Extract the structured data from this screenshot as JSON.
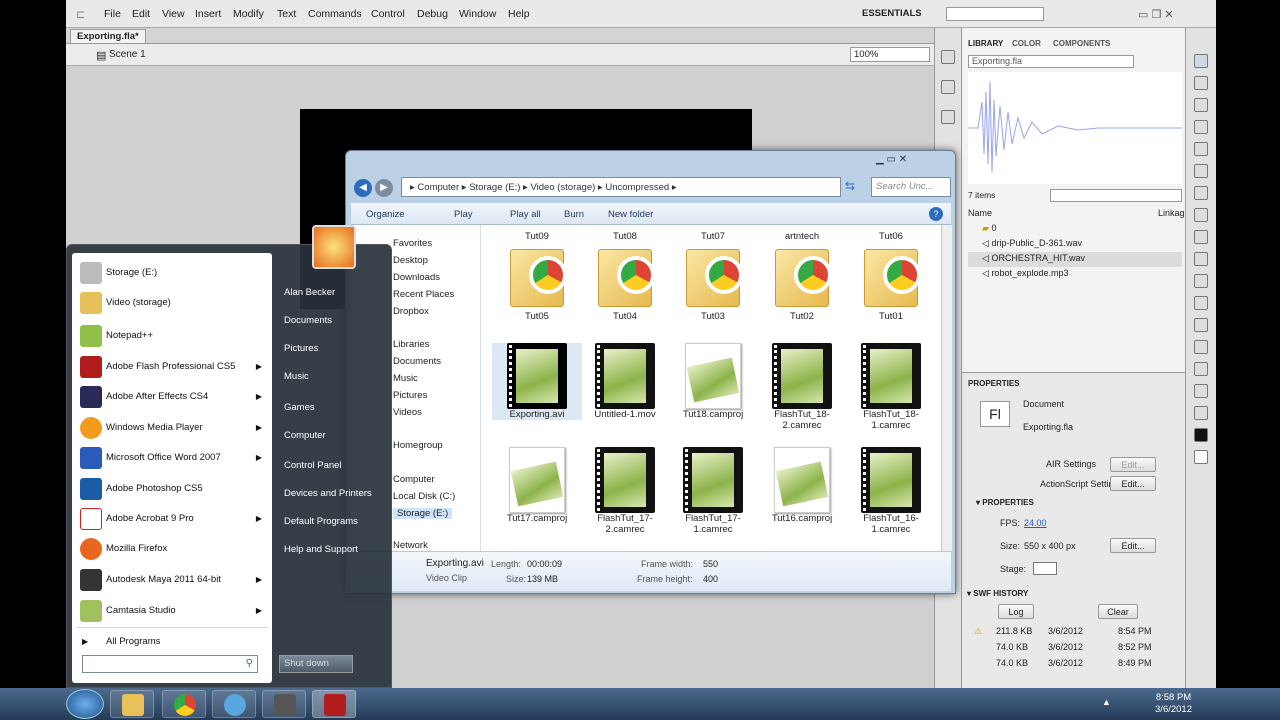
{
  "menubar": {
    "items": [
      "File",
      "Edit",
      "View",
      "Insert",
      "Modify",
      "Text",
      "Commands",
      "Control",
      "Debug",
      "Window",
      "Help"
    ],
    "workspace": "ESSENTIALS"
  },
  "document_tab": "Exporting.fla*",
  "scene": "Scene 1",
  "zoom": "100%",
  "library": {
    "tabs": [
      "LIBRARY",
      "COLOR",
      "COMPONENTS"
    ],
    "file": "Exporting.fla",
    "count": "7 items",
    "col_name": "Name",
    "col_linkage": "Linkag",
    "items": [
      "0",
      "drip-Public_D-361.wav",
      "ORCHESTRA_HIT.wav",
      "robot_explode.mp3"
    ]
  },
  "properties": {
    "tab": "PROPERTIES",
    "type_label": "Document",
    "doc_name": "Exporting.fla",
    "air_label": "AIR Settings",
    "as_label": "ActionScript Settings",
    "edit": "Edit...",
    "section": "PROPERTIES",
    "fps_label": "FPS:",
    "fps": "24.00",
    "size_label": "Size:",
    "size": "550 x 400 px",
    "stage_label": "Stage:",
    "swf_history": "SWF HISTORY",
    "log": "Log",
    "clear": "Clear",
    "history": [
      {
        "size": "211.8 KB",
        "date": "3/6/2012",
        "time": "8:54 PM"
      },
      {
        "size": "74.0 KB",
        "date": "3/6/2012",
        "time": "8:52 PM"
      },
      {
        "size": "74.0 KB",
        "date": "3/6/2012",
        "time": "8:49 PM"
      }
    ]
  },
  "explorer": {
    "breadcrumb": [
      "Computer",
      "Storage (E:)",
      "Video (storage)",
      "Uncompressed"
    ],
    "search": "Search Unc...",
    "toolbar": [
      "Organize",
      "Play",
      "Play all",
      "Burn",
      "New folder"
    ],
    "nav": [
      "Favorites",
      "Desktop",
      "Downloads",
      "Recent Places",
      "Dropbox",
      "Libraries",
      "Documents",
      "Music",
      "Pictures",
      "Videos",
      "Homegroup",
      "Computer",
      "Local Disk (C:)",
      "Storage (E:)",
      "Network"
    ],
    "row0": [
      "Tut09",
      "Tut08",
      "Tut07",
      "artntech",
      "Tut06"
    ],
    "row1": [
      "Tut05",
      "Tut04",
      "Tut03",
      "Tut02",
      "Tut01"
    ],
    "row2": [
      "Exporting.avi",
      "Untitled-1.mov",
      "Tut18.camproj",
      "FlashTut_18-2.camrec",
      "FlashTut_18-1.camrec"
    ],
    "row3": [
      "Tut17.camproj",
      "FlashTut_17-2.camrec",
      "FlashTut_17-1.camrec",
      "Tut16.camproj",
      "FlashTut_16-1.camrec"
    ],
    "details": {
      "name": "Exporting.avi",
      "type": "Video Clip",
      "length_label": "Length:",
      "length": "00:00:09",
      "size_label": "Size:",
      "size": "139 MB",
      "fw_label": "Frame width:",
      "fw": "550",
      "fh_label": "Frame height:",
      "fh": "400"
    }
  },
  "startmenu": {
    "left": [
      "Storage (E:)",
      "Video (storage)",
      "Notepad++",
      "Adobe Flash Professional CS5",
      "Adobe After Effects CS4",
      "Windows Media Player",
      "Microsoft Office Word 2007",
      "Adobe Photoshop CS5",
      "Adobe Acrobat 9 Pro",
      "Mozilla Firefox",
      "Autodesk Maya 2011 64-bit",
      "Camtasia Studio"
    ],
    "all_programs": "All Programs",
    "right": [
      "Alan Becker",
      "Documents",
      "Pictures",
      "Music",
      "Games",
      "Computer",
      "Control Panel",
      "Devices and Printers",
      "Default Programs",
      "Help and Support"
    ],
    "shutdown": "Shut down"
  },
  "clock": {
    "time": "8:58 PM",
    "date": "3/6/2012"
  }
}
